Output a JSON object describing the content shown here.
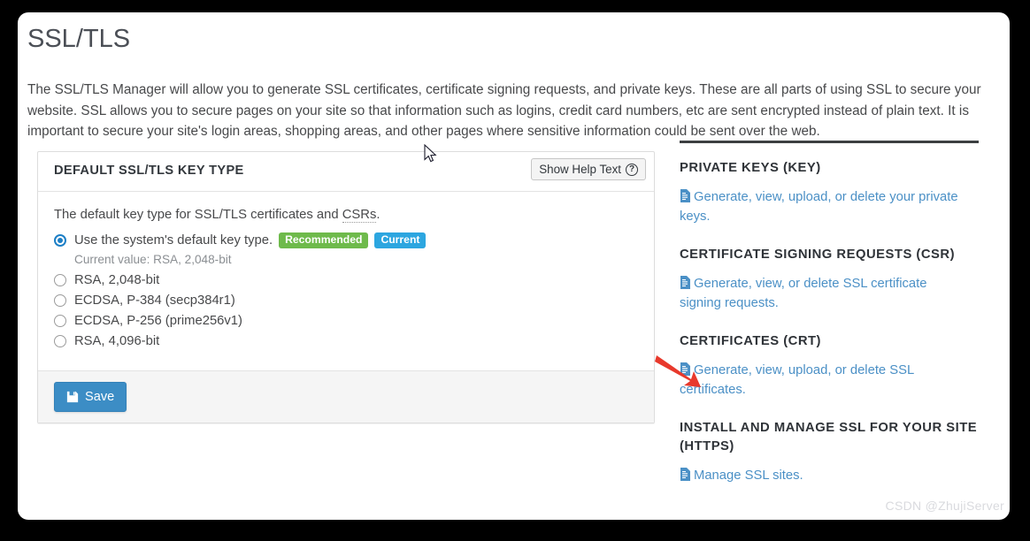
{
  "page": {
    "title": "SSL/TLS",
    "intro": "The SSL/TLS Manager will allow you to generate SSL certificates, certificate signing requests, and private keys. These are all parts of using SSL to secure your website. SSL allows you to secure pages on your site so that information such as logins, credit card numbers, etc are sent encrypted instead of plain text. It is important to secure your site's login areas, shopping areas, and other pages where sensitive information could be sent over the web."
  },
  "panel": {
    "heading": "DEFAULT SSL/TLS KEY TYPE",
    "help_button": "Show Help Text",
    "help_icon": "question-circle-icon",
    "description_before": "The default key type for SSL/TLS certificates and ",
    "description_abbr": "CSRs",
    "description_after": ".",
    "options": [
      {
        "label": "Use the system's default key type.",
        "selected": true,
        "badges": [
          {
            "text": "Recommended",
            "color": "#6eba4b"
          },
          {
            "text": "Current",
            "color": "#2ca6e0"
          }
        ]
      },
      {
        "label": "RSA, 2,048-bit",
        "selected": false,
        "badges": []
      },
      {
        "label": "ECDSA, P-384 (secp384r1)",
        "selected": false,
        "badges": []
      },
      {
        "label": "ECDSA, P-256 (prime256v1)",
        "selected": false,
        "badges": []
      },
      {
        "label": "RSA, 4,096-bit",
        "selected": false,
        "badges": []
      }
    ],
    "current_value": "Current value: RSA, 2,048-bit",
    "save_label": "Save",
    "save_icon": "save-floppy-icon",
    "save_color": "#3c8dc5"
  },
  "sidebar": {
    "groups": [
      {
        "heading": "PRIVATE KEYS (KEY)",
        "link": "Generate, view, upload, or delete your private keys.",
        "icon": "document-icon"
      },
      {
        "heading": "CERTIFICATE SIGNING REQUESTS (CSR)",
        "link": "Generate, view, or delete SSL certificate signing requests.",
        "icon": "document-icon"
      },
      {
        "heading": "CERTIFICATES (CRT)",
        "link": "Generate, view, upload, or delete SSL certificates.",
        "icon": "document-icon"
      },
      {
        "heading": "INSTALL AND MANAGE SSL FOR YOUR SITE (HTTPS)",
        "link": "Manage SSL sites.",
        "icon": "document-icon"
      }
    ],
    "link_color": "#4b90c6"
  },
  "annotation": {
    "arrow_color": "#e8392c"
  },
  "watermark": "CSDN @ZhujiServer"
}
